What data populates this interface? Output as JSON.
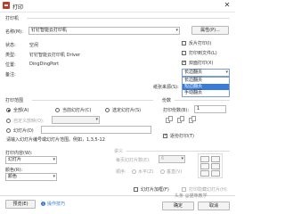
{
  "window": {
    "title": "打印",
    "close": "✕"
  },
  "printer": {
    "group_title": "打印机",
    "name_label": "名称(M):",
    "name_value": "钉钉智能云打印机",
    "properties_button": "属性(P)...",
    "status_label": "状态:",
    "status_value": "空闲",
    "type_label": "类型:",
    "type_value": "钉钉智能云打印机 Driver",
    "location_label": "位置:",
    "location_value": "DingDingPort",
    "comment_label": "备注:"
  },
  "options": {
    "reverse_print": "反片打印(I)",
    "print_to_file": "打印到文件(L)",
    "duplex": "双面打印(X)",
    "duplex_checked": true,
    "flip_select_value": "长边翻页",
    "flip_options": [
      "长边翻页",
      "短边翻页",
      "手动翻页"
    ],
    "flip_selected_index": 1,
    "paper_source_label": "纸张来源(S):"
  },
  "range": {
    "group_title": "打印范围",
    "all": "全部(A)",
    "current_slide": "当前幻灯片(C)",
    "selection": "选定幻灯片(S)",
    "custom_show": "自定义放映(O):",
    "slides": "幻灯片(D)",
    "hint": "请输入幻灯片编号或幻灯片范围。例如，1,3,5-12"
  },
  "copies": {
    "group_title": "份数",
    "count_label": "打印份数(B):",
    "count_value": "1",
    "collate": "逐份打印(T)",
    "collate_checked": true
  },
  "print_what": {
    "label": "打印内容(W):",
    "value": "幻灯片"
  },
  "color": {
    "label": "颜色(R):",
    "value": "颜色"
  },
  "handouts": {
    "group_title": "讲义",
    "per_page_label": "每页幻灯片数(E):",
    "per_page_value": "6",
    "order_label": "顺序:",
    "horizontal": "水平(Z)",
    "vertical": "垂直(V)"
  },
  "bottom": {
    "frame_slides": "幻灯片加框(F)",
    "print_hidden": "打印隐藏幻灯片(H)",
    "preview_button": "预览(E)",
    "tips": "操作技巧",
    "watermark": "头条 @猫咪教学",
    "ok_button": "确定",
    "cancel_button": "取消"
  },
  "colors": {
    "accent": "#3a7bd5",
    "disabled": "#a8a8a8"
  }
}
